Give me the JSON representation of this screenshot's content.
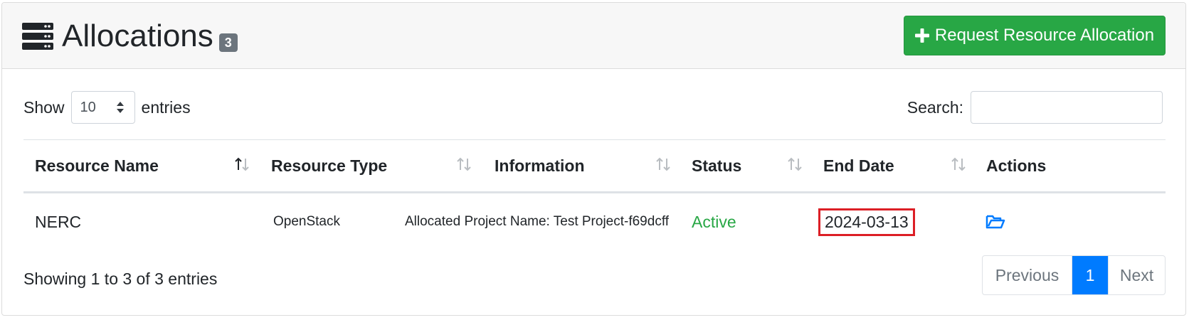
{
  "header": {
    "title": "Allocations",
    "count_badge": "3",
    "request_button_label": "Request Resource Allocation"
  },
  "controls": {
    "show_label": "Show",
    "page_length_value": "10",
    "entries_label": "entries",
    "search_label": "Search:",
    "search_value": ""
  },
  "table": {
    "columns": [
      "Resource Name",
      "Resource Type",
      "Information",
      "Status",
      "End Date",
      "Actions"
    ],
    "rows": [
      {
        "resource_name": "NERC",
        "resource_type": "OpenStack",
        "information": "Allocated Project Name: Test Project-f69dcff",
        "status": "Active",
        "end_date": "2024-03-13",
        "action_icon": "folder-open-icon"
      }
    ]
  },
  "footer": {
    "info": "Showing 1 to 3 of 3 entries",
    "pagination": {
      "previous_label": "Previous",
      "current_page": "1",
      "next_label": "Next"
    }
  },
  "colors": {
    "primary_button": "#28a745",
    "status_active": "#28a745",
    "pagination_active": "#007bff",
    "highlight_border": "#dc1f26",
    "badge": "#6c757d"
  }
}
